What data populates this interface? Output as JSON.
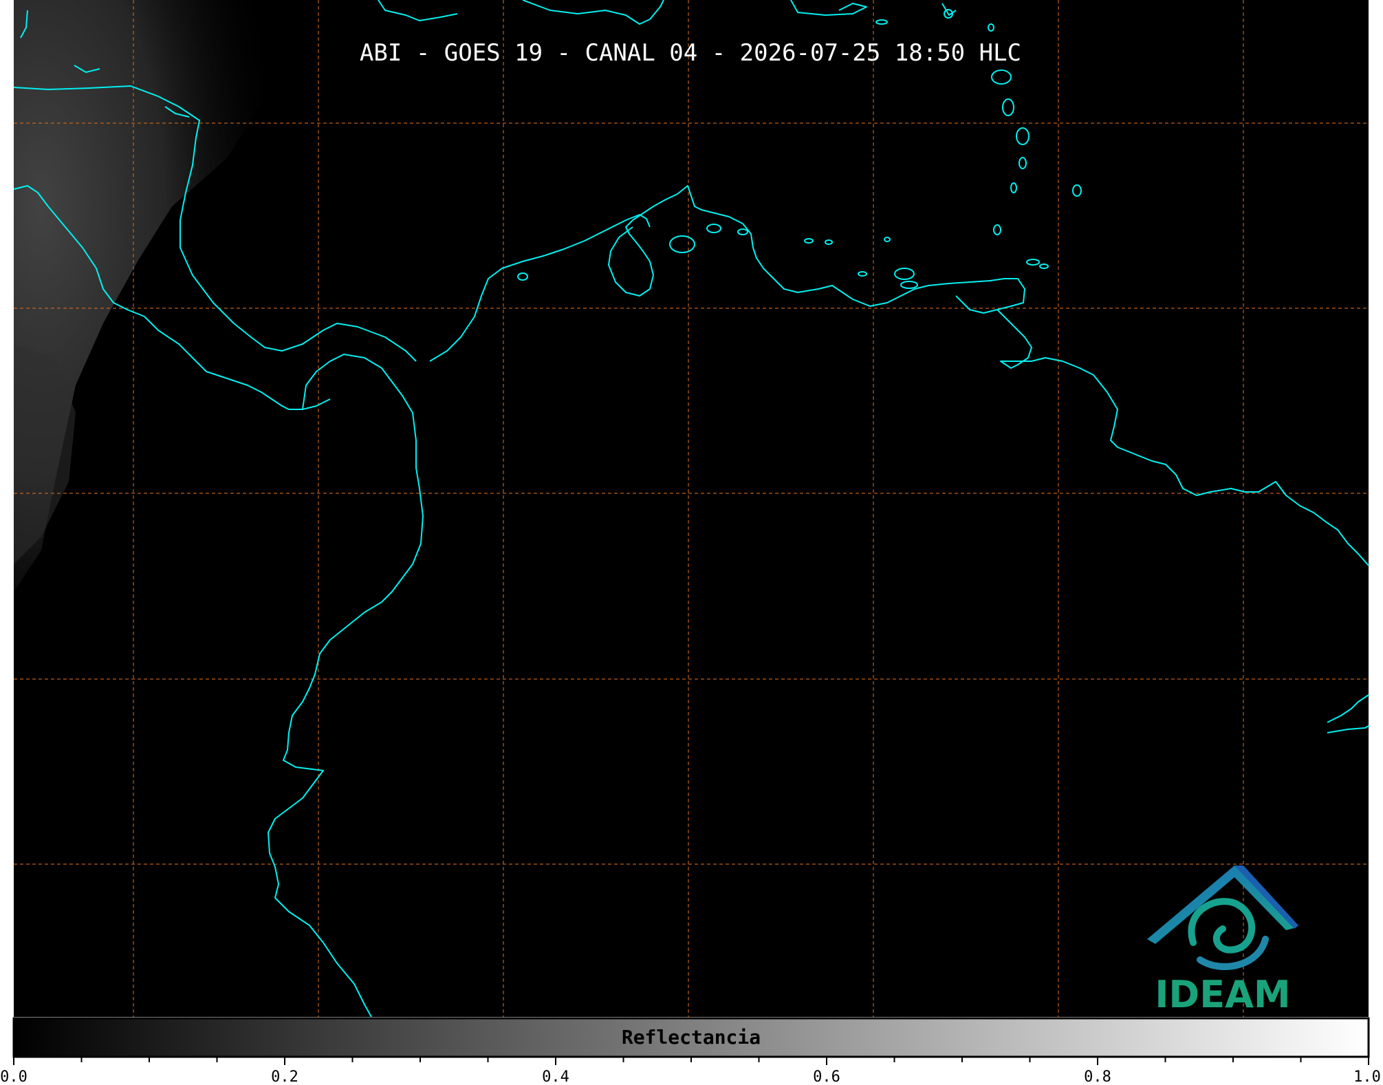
{
  "title": "ABI - GOES 19 - CANAL 04 - 2026-07-25 18:50 HLC",
  "colorbar": {
    "label": "Reflectancia",
    "ticks": [
      "0.0",
      "0.2",
      "0.4",
      "0.6",
      "0.8",
      "1.0"
    ],
    "range": [
      0.0,
      1.0
    ],
    "colormap": "grayscale"
  },
  "logo": {
    "text": "IDEAM"
  },
  "colors": {
    "background": "#000000",
    "coastline": "#00f0f0",
    "gridlines": "#d2691e",
    "logo_text": "#1aa37a",
    "logo_mountain": "#1b78b8",
    "logo_swirl": "#17a28f"
  }
}
